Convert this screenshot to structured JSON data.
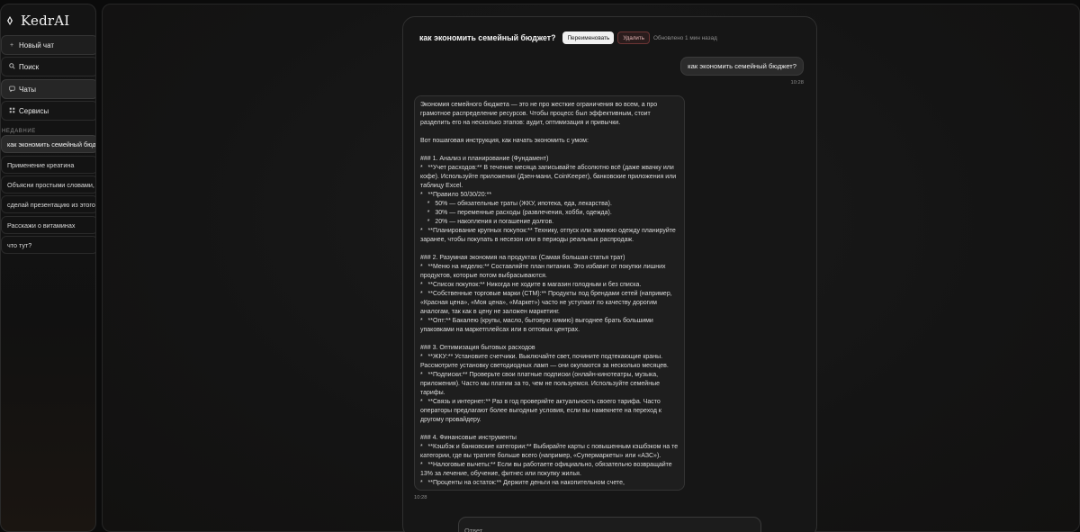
{
  "app": {
    "name": "KedrAI"
  },
  "sidebar": {
    "nav": [
      {
        "label": "Новый чат",
        "icon": "plus-icon"
      },
      {
        "label": "Поиск",
        "icon": "search-icon"
      },
      {
        "label": "Чаты",
        "icon": "chat-icon"
      },
      {
        "label": "Сервисы",
        "icon": "grid-icon"
      }
    ],
    "recent_heading": "НЕДАВНИЕ",
    "recent": [
      "как экономить семейный бюджет?",
      "Применение креатина",
      "Объясни простыми словами, как работает",
      "сделай презентацию из этого",
      "Расскажи о витаминах",
      "что тут?"
    ]
  },
  "chat": {
    "title": "как экономить семейный бюджет?",
    "rename_label": "Переименовать",
    "delete_label": "Удалить",
    "updated": "Обновлено 1 мин назад",
    "user_message": "как экономить семейный бюджет?",
    "user_time": "10:28",
    "ai_time": "10:28",
    "ai_message": "Экономия семейного бюджета — это не про жесткие ограничения во всем, а про\nграмотное распределение ресурсов. Чтобы процесс был эффективным, стоит\nразделить его на несколько этапов: аудит, оптимизация и привычки.\n\nВот пошаговая инструкция, как начать экономить с умом:\n\n### 1. Анализ и планирование (Фундамент)\n*   **Учет расходов:** В течение месяца записывайте абсолютно всё (даже жвачку или\nкофе). Используйте приложения (Дзен-мани, CoinKeeper), банковские приложения или\nтаблицу Excel.\n*   **Правило 50/30/20:**\n    *   50% — обязательные траты (ЖКУ, ипотека, еда, лекарства).\n    *   30% — переменные расходы (развлечения, хобби, одежда).\n    *   20% — накопления и погашение долгов.\n*   **Планирование крупных покупок:** Технику, отпуск или зимнюю одежду планируйте\nзаранее, чтобы покупать в несезон или в периоды реальных распродаж.\n\n### 2. Разумная экономия на продуктах (Самая большая статья трат)\n*   **Меню на неделю:** Составляйте план питания. Это избавит от покупки лишних\nпродуктов, которые потом выбрасываются.\n*   **Список покупок:** Никогда не ходите в магазин голодным и без списка.\n*   **Собственные торговые марки (СТМ):** Продукты под брендами сетей (например,\n«Красная цена», «Моя цена», «Маркет») часто не уступают по качеству дорогим\nаналогам, так как в цену не заложен маркетинг.\n*   **Опт:** Бакалею (крупы, масло, бытовую химию) выгоднее брать большими\nупаковками на маркетплейсах или в оптовых центрах.\n\n### 3. Оптимизация бытовых расходов\n*   **ЖКУ:** Установите счетчики. Выключайте свет, почините подтекающие краны.\nРассмотрите установку светодиодных ламп — они окупаются за несколько месяцев.\n*   **Подписки:** Проверьте свои платные подписки (онлайн-кинотеатры, музыка,\nприложения). Часто мы платим за то, чем не пользуемся. Используйте семейные\nтарифы.\n*   **Связь и интернет:** Раз в год проверяйте актуальность своего тарифа. Часто\nоператоры предлагают более выгодные условия, если вы намекнете на переход к\nдругому провайдеру.\n\n### 4. Финансовые инструменты\n*   **Кэшбэк и банковские категории:** Выбирайте карты с повышенным кэшбэком на те\nкатегории, где вы тратите больше всего (например, «Супермаркеты» или «АЗС»).\n*   **Налоговые вычеты:** Если вы работаете официально, обязательно возвращайте\n13% за лечение, обучение, фитнес или покупку жилья.\n*   **Проценты на остаток:** Держите деньги на накопительном счете,",
    "input_placeholder": "Ответ..."
  }
}
